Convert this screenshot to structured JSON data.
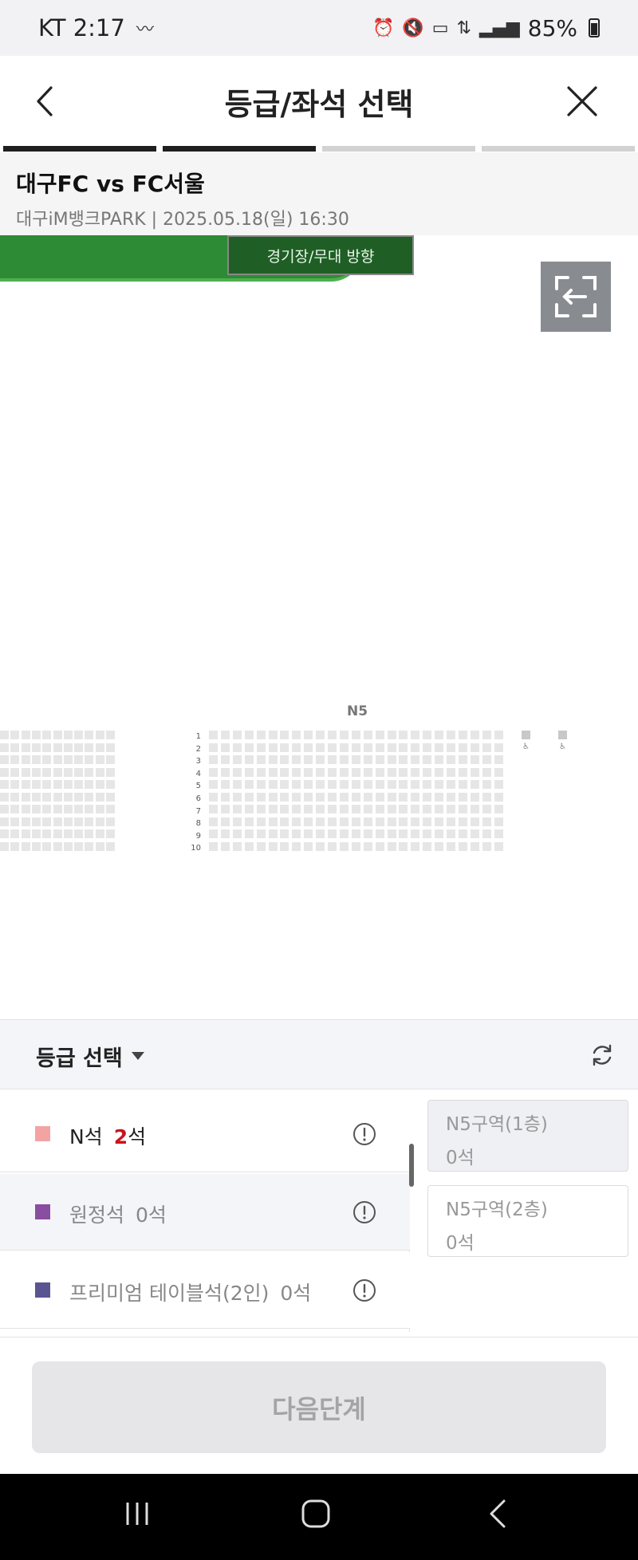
{
  "status_bar": {
    "carrier_time": "KT 2:17",
    "battery": "85%"
  },
  "header": {
    "title": "등급/좌석 선택"
  },
  "steps": {
    "total": 4,
    "active": 2
  },
  "game": {
    "match": "대구FC vs FC서울",
    "venue": "대구iM뱅크PARK | 2025.05.18(일) 16:30"
  },
  "seat_map": {
    "stage_label": "경기장/무대 방향",
    "section": "N5",
    "rows": [
      "1",
      "2",
      "3",
      "4",
      "5",
      "6",
      "7",
      "8",
      "9",
      "10"
    ],
    "stage_color": "#2e8b35"
  },
  "grades": {
    "heading": "등급 선택",
    "items": [
      {
        "name": "N석",
        "count_num": "2",
        "count_suffix": "석",
        "color": "#f4a3a3"
      },
      {
        "name": "원정석",
        "count": "0석",
        "color": "#8a4ea0"
      },
      {
        "name": "프리미엄 테이블석(2인)",
        "count": "0석",
        "color": "#5a5590"
      }
    ]
  },
  "zones": [
    {
      "name": "N5구역(1층)",
      "count": "0석"
    },
    {
      "name": "N5구역(2층)",
      "count": "0석"
    }
  ],
  "next_button": "다음단계"
}
